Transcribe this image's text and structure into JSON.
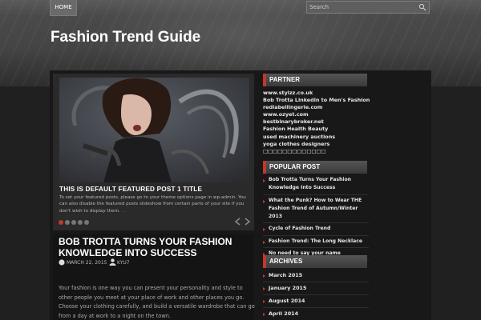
{
  "nav": {
    "home_label": "HOME"
  },
  "search": {
    "placeholder": "Search"
  },
  "site": {
    "title": "Fashion Trend Guide"
  },
  "slider": {
    "title": "THIS IS DEFAULT FEATURED POST 1 TITLE",
    "text": "To set your featured posts, please go to your theme options page in wp-admin. You can also disable the featured posts slideshow from certain parts of your site if you don't wish to display them.",
    "more_label": "..."
  },
  "post": {
    "title": "BOB TROTTA TURNS YOUR FASHION KNOWLEDGE INTO SUCCESS",
    "date": "MARCH 22, 2015",
    "author": "KYU7",
    "excerpt": "Your fashion is one way you can present your personality and style to other people you meet at your place of work and other places you go. Choose your clothing carefully, and build a versatile wardrobe that can go from a day at work to a night on the town."
  },
  "sidebar": {
    "partner": {
      "title": "PARTNER",
      "items": [
        "www.stylzz.co.uk",
        "Bob Trotta Linkedin to Men's Fashion",
        "redlabellingerie.com",
        "www.ozyet.com",
        "bestbinarybroker.net",
        "Fashion Health Beauty",
        "used machinery auctions",
        "yoga clothes designers",
        "□□□□□□□□□□□□□"
      ]
    },
    "popular": {
      "title": "POPULAR POST",
      "items": [
        "Bob Trotta Turns Your Fashion Knowledge Into Success",
        "What the Punk? How to Wear THE Fashion Trend of Autumn/Winter 2013",
        "Cycle of Fashion Trend",
        "Fashion Trend: The Long Necklace",
        "No need to say your name"
      ]
    },
    "archives": {
      "title": "ARCHIVES",
      "items": [
        "March 2015",
        "January 2015",
        "August 2014",
        "April 2014"
      ]
    }
  },
  "colors": {
    "accent": "#c0392b",
    "background": "#202020"
  }
}
